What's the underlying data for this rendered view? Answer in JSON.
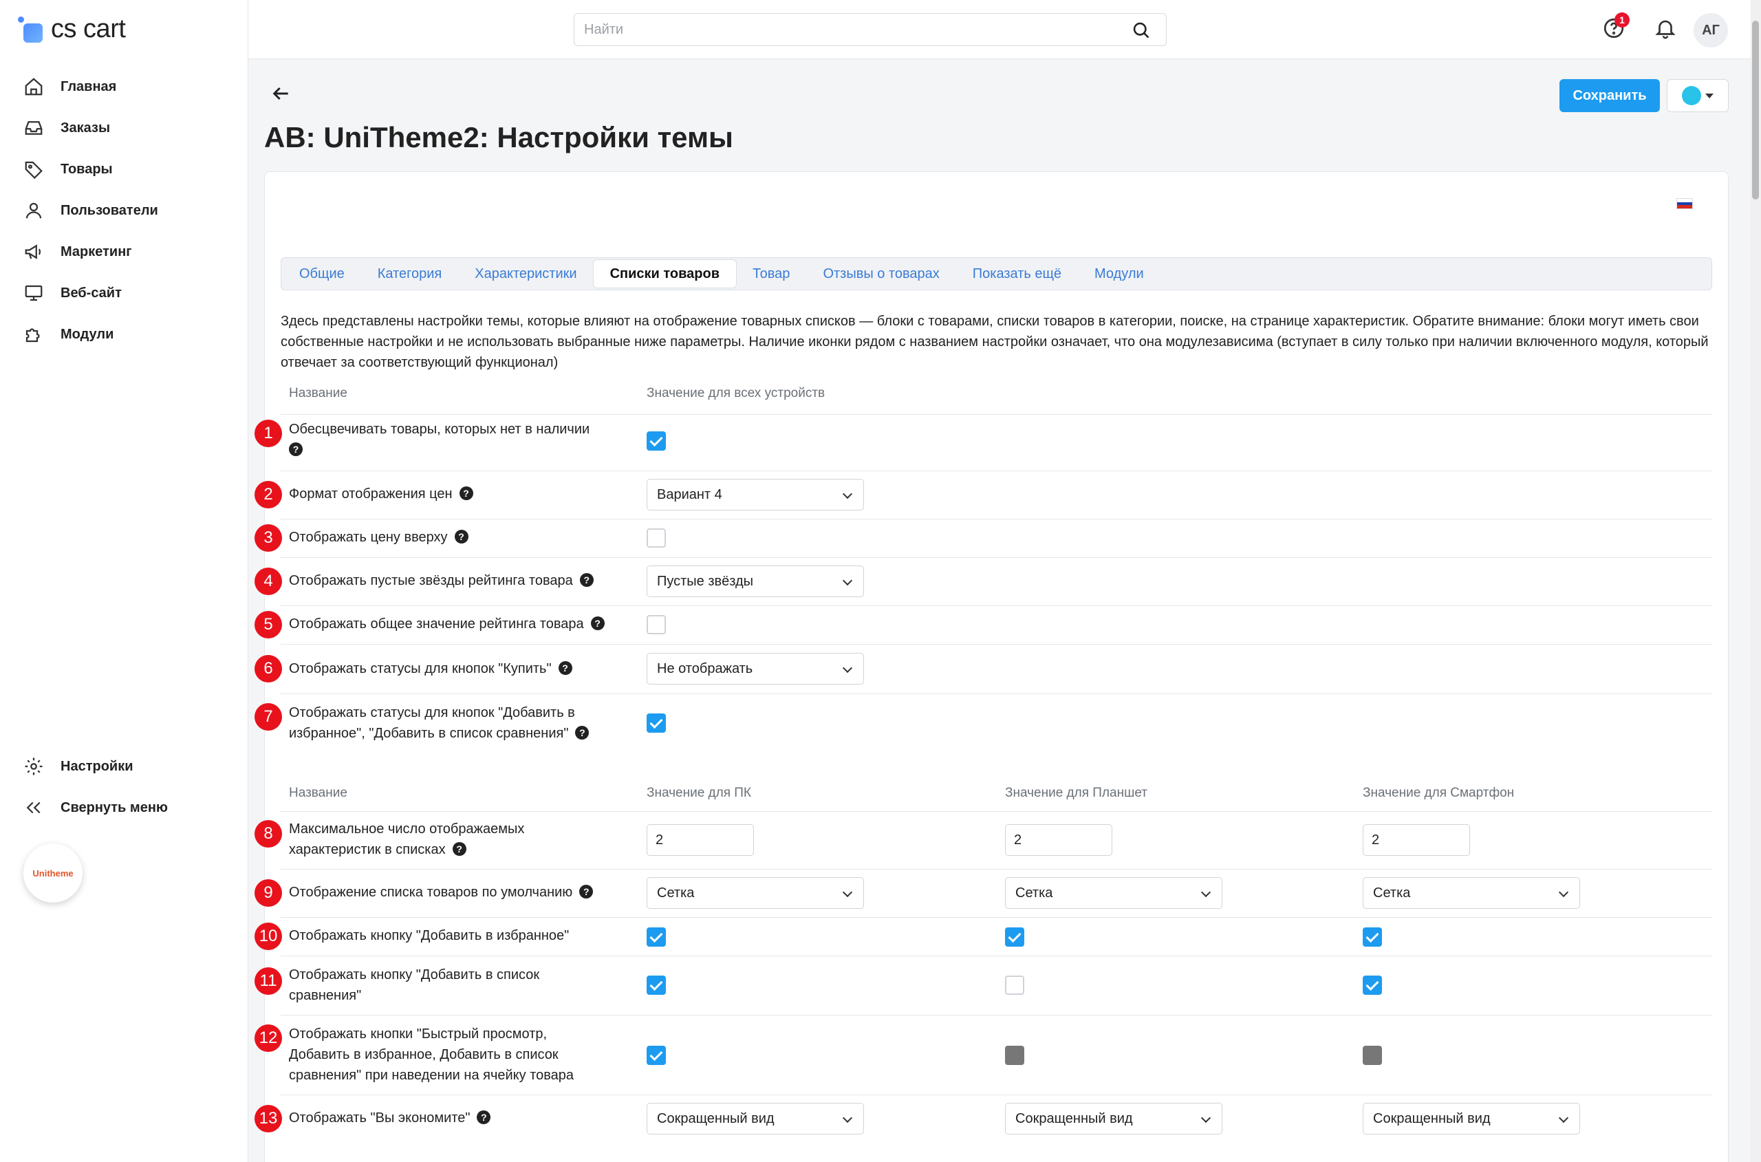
{
  "app": {
    "logo_text": "cs cart"
  },
  "sidebar": {
    "items": [
      {
        "label": "Главная",
        "icon": "home-icon"
      },
      {
        "label": "Заказы",
        "icon": "inbox-icon"
      },
      {
        "label": "Товары",
        "icon": "tag-icon"
      },
      {
        "label": "Пользователи",
        "icon": "user-icon"
      },
      {
        "label": "Маркетинг",
        "icon": "megaphone-icon"
      },
      {
        "label": "Веб-сайт",
        "icon": "monitor-icon"
      },
      {
        "label": "Модули",
        "icon": "puzzle-icon"
      }
    ],
    "settings_label": "Настройки",
    "collapse_label": "Свернуть меню",
    "badge_text": "Unitheme"
  },
  "topbar": {
    "search_placeholder": "Найти",
    "notifications_count": "1",
    "avatar_initials": "АГ"
  },
  "header": {
    "title": "AB: UniTheme2: Настройки темы",
    "save_label": "Сохранить"
  },
  "tabs": [
    {
      "label": "Общие",
      "active": false
    },
    {
      "label": "Категория",
      "active": false
    },
    {
      "label": "Характеристики",
      "active": false
    },
    {
      "label": "Списки товаров",
      "active": true
    },
    {
      "label": "Товар",
      "active": false
    },
    {
      "label": "Отзывы о товарах",
      "active": false
    },
    {
      "label": "Показать ещё",
      "active": false
    },
    {
      "label": "Модули",
      "active": false
    }
  ],
  "description": "Здесь представлены настройки темы, которые влияют на отображение товарных списков — блоки с товарами, списки товаров в категории, поиске, на странице характеристик. Обратите внимание: блоки могут иметь свои собственные настройки и не использовать выбранные ниже параметры. Наличие иконки      рядом с названием настройки означает, что она модулезависима (вступает в силу только при наличии включенного модуля, который отвечает за соответствующий функционал)",
  "table1": {
    "col_name": "Название",
    "col_value": "Значение для всех устройств",
    "rows": [
      {
        "num": "1",
        "label": "Обесцвечивать товары, которых нет в наличии",
        "value": "Да"
      },
      {
        "num": "2",
        "label": "Формат отображения цен",
        "value": "Вариант 4"
      },
      {
        "num": "3",
        "label": "Отображать цену вверху",
        "value": "Нет"
      },
      {
        "num": "4",
        "label": "Отображать пустые звёзды рейтинга товара",
        "value": "Пустые звёзды"
      },
      {
        "num": "5",
        "label": "Отображать общее значение рейтинга товара",
        "value": "Нет"
      },
      {
        "num": "6",
        "label": "Отображать статусы для кнопок \"Купить\"",
        "value": "Не отображать"
      },
      {
        "num": "7",
        "label": "Отображать статусы для кнопок \"Добавить в избранное\", \"Добавить в список сравнения\"",
        "value": "Да"
      }
    ]
  },
  "table2": {
    "col_name": "Название",
    "col_pc": "Значение для ПК",
    "col_tablet": "Значение для Планшет",
    "col_phone": "Значение для Смартфон",
    "rows": [
      {
        "num": "8",
        "label": "Максимальное число отображаемых характеристик в списках",
        "pc": "2",
        "tablet": "2",
        "phone": "2"
      },
      {
        "num": "9",
        "label": "Отображение списка товаров по умолчанию",
        "pc": "Сетка",
        "tablet": "Сетка",
        "phone": "Сетка"
      },
      {
        "num": "10",
        "label": "Отображать кнопку \"Добавить в избранное\"",
        "pc": "Да",
        "tablet": "Да",
        "phone": "Да"
      },
      {
        "num": "11",
        "label": "Отображать кнопку \"Добавить в список сравнения\"",
        "pc": "Да",
        "tablet": "Нет",
        "phone": "Да"
      },
      {
        "num": "12",
        "label": "Отображать кнопки \"Быстрый просмотр, Добавить в избранное, Добавить в список сравнения\" при наведении на ячейку товара",
        "pc": "Да",
        "tablet": "Отключено",
        "phone": "Отключено"
      },
      {
        "num": "13",
        "label": "Отображать \"Вы экономите\"",
        "pc": "Сокращенный вид",
        "tablet": "Сокращенный вид",
        "phone": "Сокращенный вид"
      }
    ]
  },
  "colors": {
    "accent": "#1d9bf0",
    "marker": "#e8121c"
  }
}
